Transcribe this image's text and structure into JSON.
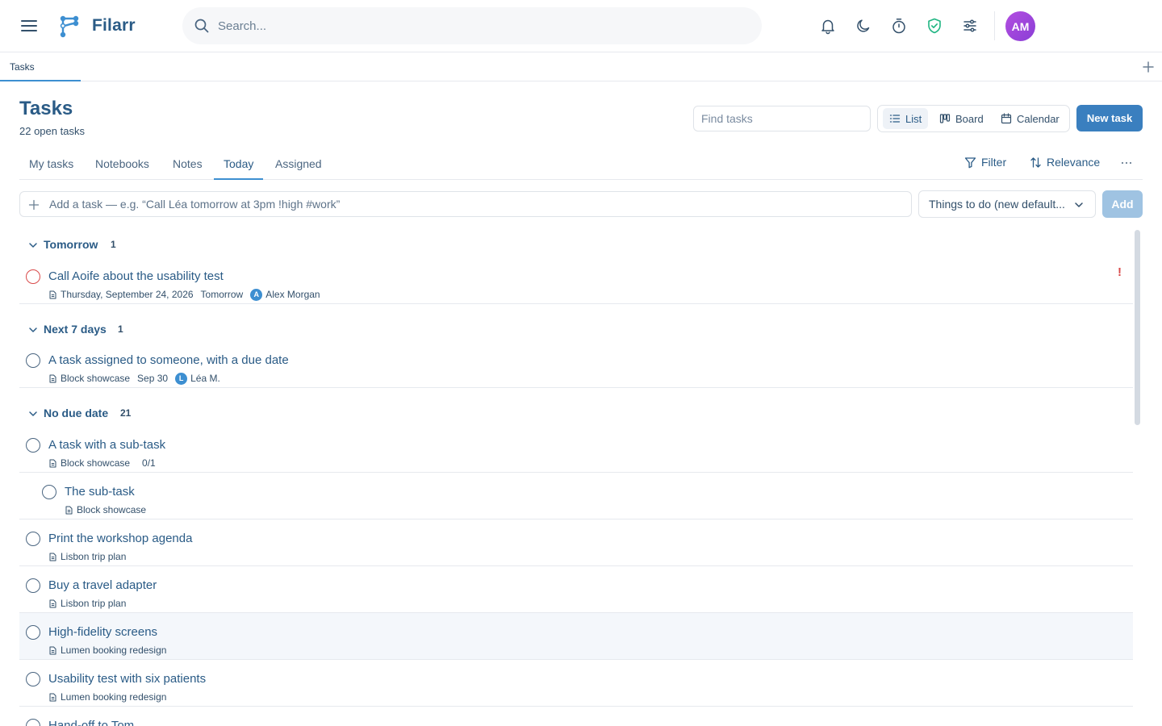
{
  "app": {
    "brand": "Filarr",
    "search_placeholder": "Search...",
    "avatar_initials": "AM",
    "accent": "#3a7fbf",
    "avatar_color": "#9b45dd"
  },
  "doc_tab": {
    "label": "Tasks"
  },
  "header": {
    "title": "Tasks",
    "subtitle": "22 open tasks",
    "find_placeholder": "Find tasks",
    "views": [
      "List",
      "Board",
      "Calendar"
    ],
    "active_view": "List",
    "new_task_label": "New task"
  },
  "filter_tabs": {
    "items": [
      "My tasks",
      "Notebooks",
      "Notes",
      "Today",
      "Assigned"
    ],
    "active": "Today",
    "filter_label": "Filter",
    "sort_label": "Relevance"
  },
  "quick_add": {
    "placeholder": "Add a task — e.g. “Call Léa tomorrow at 3pm !high #work”",
    "list_selected": "Things to do (new default...",
    "add_label": "Add"
  },
  "groups": [
    {
      "label": "Tomorrow",
      "count": "1",
      "tasks": [
        {
          "title": "Call Aoife about the usability test",
          "doc": "Thursday, September 24, 2026",
          "due": "Tomorrow",
          "assignee_initial": "A",
          "assignee": "Alex Morgan",
          "priority": "!"
        }
      ]
    },
    {
      "label": "Next 7 days",
      "count": "1",
      "tasks": [
        {
          "title": "A task assigned to someone, with a due date",
          "doc": "Block showcase",
          "due": "Sep 30",
          "assignee_initial": "L",
          "assignee": "Léa M."
        }
      ]
    },
    {
      "label": "No due date",
      "count": "21",
      "tasks": [
        {
          "title": "A task with a sub-task",
          "doc": "Block showcase",
          "subtasks": "0/1"
        },
        {
          "title": "The sub-task",
          "doc": "Block showcase"
        },
        {
          "title": "Print the workshop agenda",
          "doc": "Lisbon trip plan"
        },
        {
          "title": "Buy a travel adapter",
          "doc": "Lisbon trip plan"
        },
        {
          "title": "High-fidelity screens",
          "doc": "Lumen booking redesign"
        },
        {
          "title": "Usability test with six patients",
          "doc": "Lumen booking redesign"
        },
        {
          "title": "Hand-off to Tom",
          "doc": ""
        }
      ]
    }
  ]
}
